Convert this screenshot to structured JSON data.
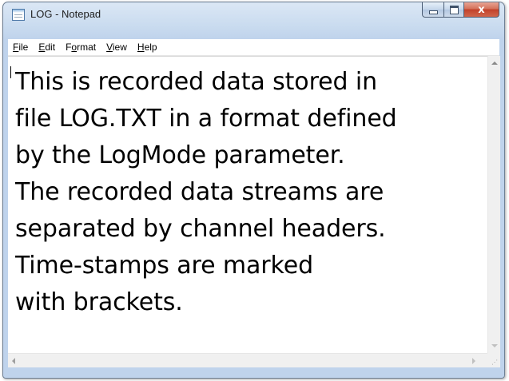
{
  "window": {
    "title": "LOG - Notepad",
    "close_glyph": "x",
    "icons": {
      "app": "notepad-icon",
      "minimize": "minimize-icon",
      "maximize": "maximize-icon",
      "close": "close-icon"
    }
  },
  "menu": {
    "items": [
      {
        "accel": "F",
        "rest": "ile"
      },
      {
        "accel": "E",
        "rest": "dit"
      },
      {
        "pre": "F",
        "accel": "o",
        "rest": "rmat"
      },
      {
        "accel": "V",
        "rest": "iew"
      },
      {
        "accel": "H",
        "rest": "elp"
      }
    ]
  },
  "document": {
    "lines": [
      "This is recorded data stored in",
      "file LOG.TXT in a format defined",
      "by the LogMode parameter.",
      "The recorded data streams are",
      "separated by channel headers.",
      "Time-stamps are marked",
      "with brackets."
    ]
  },
  "colors": {
    "titlebar": "#c9dbef",
    "close_button": "#c2412a",
    "text": "#000000"
  }
}
